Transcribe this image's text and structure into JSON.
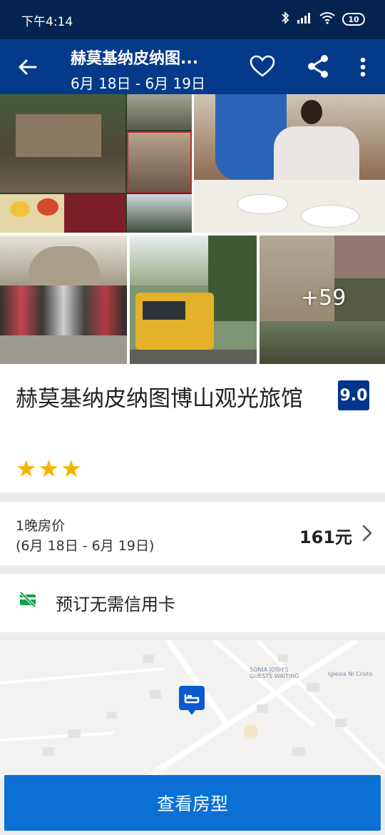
{
  "status": {
    "time": "下午4:14",
    "battery": "10"
  },
  "appbar": {
    "title": "赫莫基纳皮纳图...",
    "dates": "6月 18日 - 6月 19日"
  },
  "gallery": {
    "more_count": "+59"
  },
  "hotel": {
    "name": "赫莫基纳皮纳图博山观光旅馆",
    "score": "9.0",
    "stars": "★★★"
  },
  "price": {
    "label": "1晚房价",
    "dates": "(6月 18日 - 6月 19日)",
    "amount": "161元"
  },
  "booking": {
    "no_card": "预订无需信用卡"
  },
  "map": {
    "label_1": "SONIA JOSH'S\nGUESTS WAITING",
    "label_2": "Iglesia Ni Cristo"
  },
  "cta": {
    "label": "查看房型"
  }
}
